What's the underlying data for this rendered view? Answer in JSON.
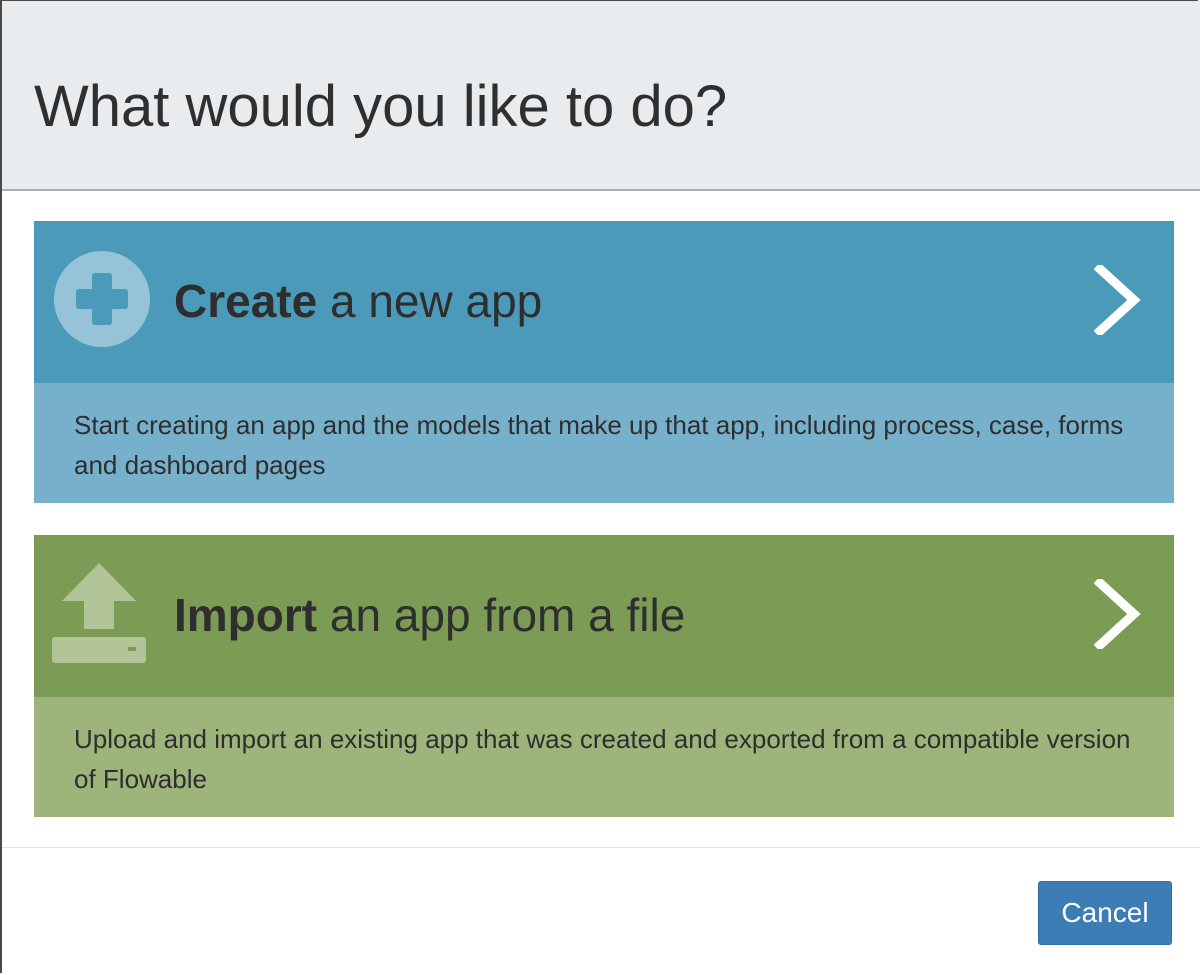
{
  "dialog": {
    "title": "What would you like to do?"
  },
  "options": [
    {
      "label_bold": "Create",
      "label_rest": " a new app",
      "description": "Start creating an app and the models that make up that app, including process, case, forms and dashboard pages",
      "icon": "plus-circle-icon",
      "color_head": "#4b9aba",
      "color_desc": "#76b0cb"
    },
    {
      "label_bold": "Import",
      "label_rest": " an app from a file",
      "description": "Upload and import an existing app that was created and exported from a compatible version of Flowable",
      "icon": "upload-icon",
      "color_head": "#7c9c55",
      "color_desc": "#9db57b"
    }
  ],
  "footer": {
    "cancel_label": "Cancel",
    "cancel_color": "#3d7db6"
  }
}
